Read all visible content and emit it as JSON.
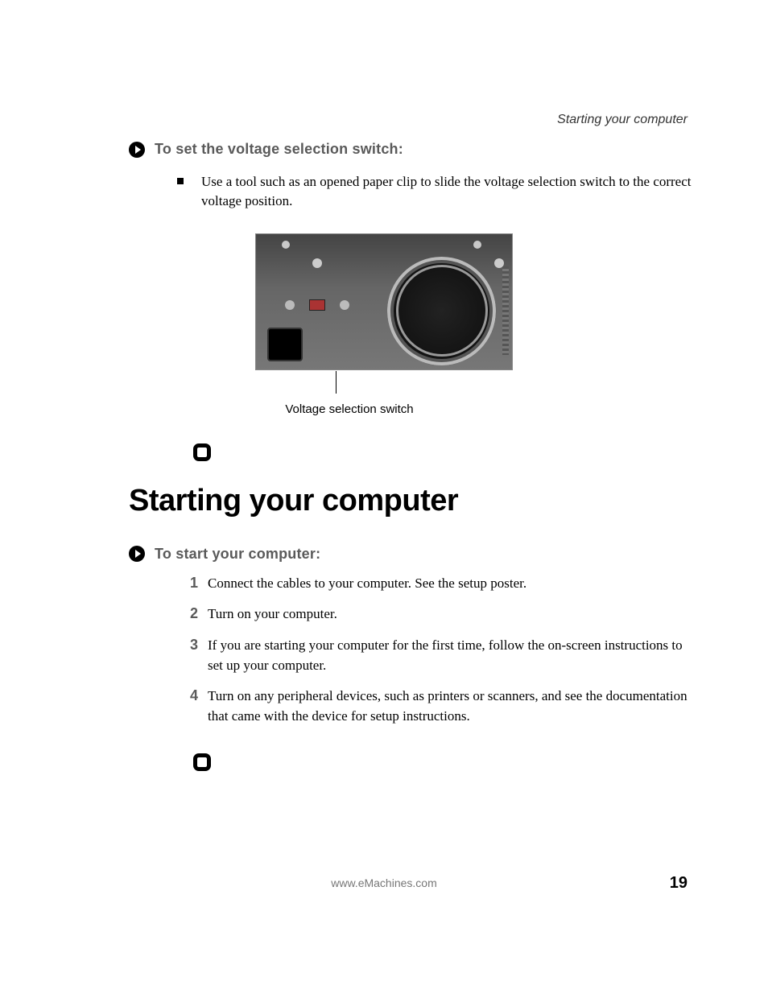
{
  "running_head": "Starting your computer",
  "section_voltage": {
    "heading": "To set the voltage selection switch:",
    "bullet": "Use a tool such as an opened paper clip to slide the voltage selection switch to the correct voltage position.",
    "figure_caption": "Voltage selection switch"
  },
  "title": "Starting your computer",
  "section_start": {
    "heading": "To start your computer:",
    "steps": [
      "Connect the cables to your computer. See the setup poster.",
      "Turn on your computer.",
      "If you are starting your computer for the first time, follow the on-screen instructions to set up your computer.",
      "Turn on any peripheral devices, such as printers or scanners, and see the documentation that came with the device for setup instructions."
    ],
    "numbers": [
      "1",
      "2",
      "3",
      "4"
    ]
  },
  "footer": {
    "url": "www.eMachines.com",
    "page": "19"
  }
}
